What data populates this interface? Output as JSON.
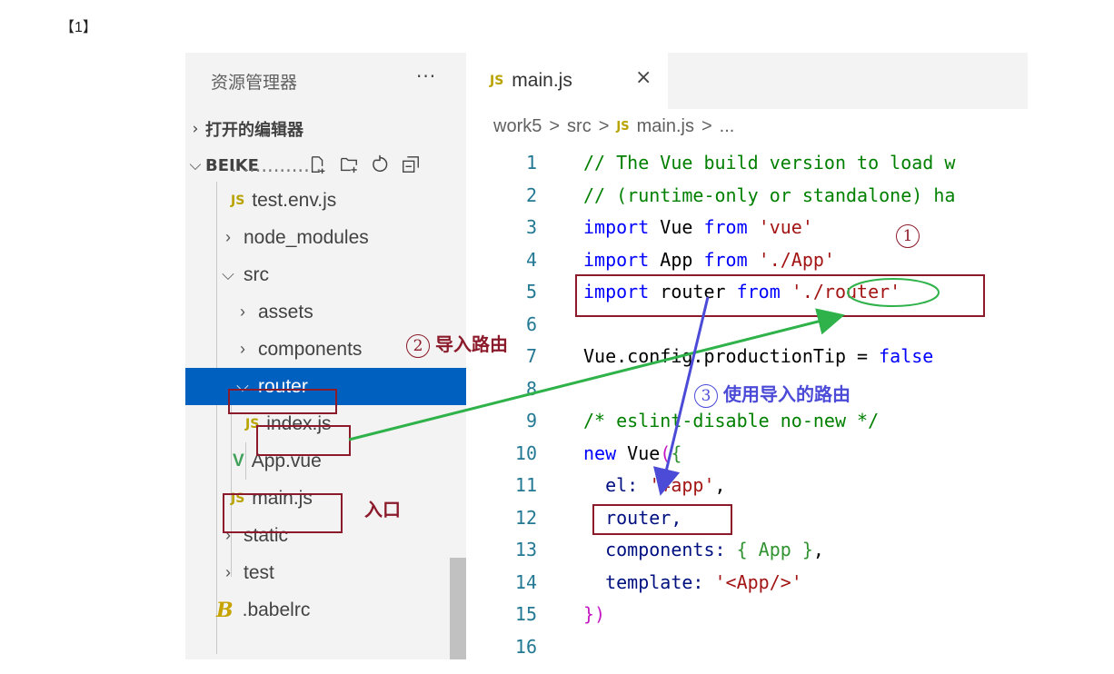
{
  "ref_label": "【1】",
  "explorer": {
    "title": "资源管理器",
    "more": "···",
    "open_editors": "打开的编辑器",
    "project": "BEIKE",
    "tree": [
      {
        "name": "test.env.js",
        "icon": "js",
        "depth": 2
      },
      {
        "name": "node_modules",
        "icon": "chevron-right",
        "depth": 1
      },
      {
        "name": "src",
        "icon": "chevron-down",
        "depth": 1
      },
      {
        "name": "assets",
        "icon": "chevron-right",
        "depth": 2
      },
      {
        "name": "components",
        "icon": "chevron-right",
        "depth": 2
      },
      {
        "name": "router",
        "icon": "chevron-down",
        "depth": 2,
        "selected": true
      },
      {
        "name": "index.js",
        "icon": "js",
        "depth": 3
      },
      {
        "name": "App.vue",
        "icon": "vue",
        "depth": 2
      },
      {
        "name": "main.js",
        "icon": "js",
        "depth": 2
      },
      {
        "name": "static",
        "icon": "chevron-right",
        "depth": 1
      },
      {
        "name": "test",
        "icon": "chevron-right",
        "depth": 1
      },
      {
        "name": ".babelrc",
        "icon": "babel",
        "depth": 1
      }
    ]
  },
  "editor": {
    "tab": {
      "icon_text": "JS",
      "name": "main.js",
      "close": "×"
    },
    "breadcrumb": [
      "work5",
      "src",
      "main.js",
      "..."
    ],
    "breadcrumb_sep": ">",
    "lines": [
      {
        "n": "1"
      },
      {
        "n": "2"
      },
      {
        "n": "3"
      },
      {
        "n": "4"
      },
      {
        "n": "5"
      },
      {
        "n": "6"
      },
      {
        "n": "7"
      },
      {
        "n": "8"
      },
      {
        "n": "9"
      },
      {
        "n": "10"
      },
      {
        "n": "11"
      },
      {
        "n": "12"
      },
      {
        "n": "13"
      },
      {
        "n": "14"
      },
      {
        "n": "15"
      },
      {
        "n": "16"
      }
    ],
    "code": {
      "l1": "// The Vue build version to load w",
      "l2": "// (runtime-only or standalone) ha",
      "import": "import",
      "from": "from",
      "vue_id": " Vue ",
      "vue_str": "'vue'",
      "app_id": " App ",
      "app_str": "'./App'",
      "router_id": " router ",
      "router_str": "'./router'",
      "config": "Vue.config.productionTip = ",
      "false": "false",
      "l9": "/* eslint-disable no-new */",
      "new": "new",
      "vue_call": " Vue",
      "paren_open": "(",
      "brace_open": "{",
      "el_key": "  el: ",
      "el_val": "'#app'",
      "comma": ",",
      "router_prop": "  router,",
      "comp_key": "  components: ",
      "comp_val": "{ App }",
      "tpl_key": "  template: ",
      "tpl_val": "'<App/>'",
      "close": "})"
    }
  },
  "annotations": {
    "a1": {
      "num": "1",
      "text": ""
    },
    "a2": {
      "num": "2",
      "text": "导入路由"
    },
    "a3": {
      "num": "3",
      "text": "使用导入的路由"
    },
    "entry": "入口"
  },
  "colors": {
    "annotation_red": "#8b1a2a",
    "arrow_green": "#2fb24a",
    "arrow_blue": "#4b4bd8"
  }
}
